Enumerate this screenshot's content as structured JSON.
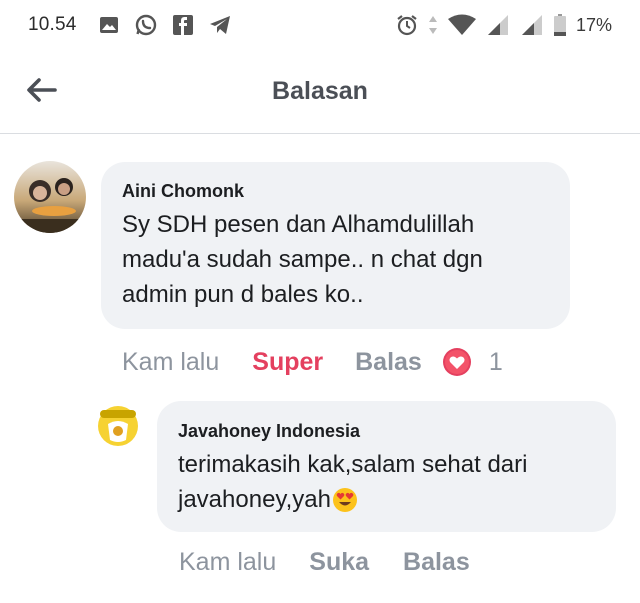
{
  "status_bar": {
    "time": "10.54",
    "battery": "17%"
  },
  "header": {
    "title": "Balasan"
  },
  "comments": [
    {
      "author": "Aini Chomonk",
      "text_lines": [
        "Sy SDH pesen dan Alhamdulillah",
        "madu'a sudah sampe.. n chat dgn",
        "admin pun d bales ko.."
      ],
      "time": "Kam lalu",
      "reaction_label": "Super",
      "reply_label": "Balas",
      "reaction_count": "1"
    },
    {
      "author": "Javahoney Indonesia",
      "text_lines": [
        "terimakasih kak,salam sehat dari",
        "javahoney,yah"
      ],
      "time": "Kam lalu",
      "like_label": "Suka",
      "reply_label": "Balas"
    }
  ],
  "colors": {
    "super": "#e4405f",
    "bubble": "#f0f2f5",
    "muted": "#8d949e"
  }
}
